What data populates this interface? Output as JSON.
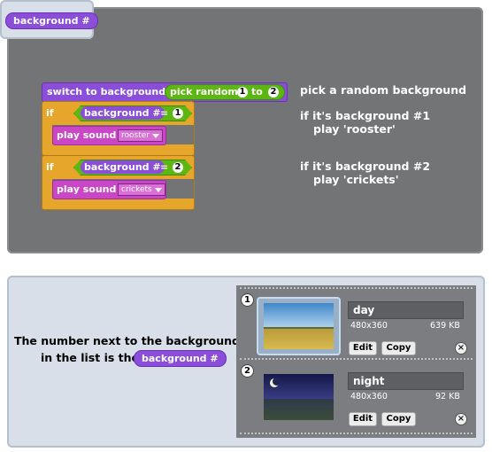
{
  "top_reporter": "background #",
  "script": {
    "switch_label": "switch to background",
    "pick_random_label": "pick random",
    "pick_random_from": "1",
    "pick_random_to_label": "to",
    "pick_random_to": "2",
    "if1": {
      "if_label": "if",
      "predicate_label": "background #",
      "equals": "=",
      "value": "1",
      "play_label": "play sound",
      "sound": "rooster"
    },
    "if2": {
      "if_label": "if",
      "predicate_label": "background #",
      "equals": "=",
      "value": "2",
      "play_label": "play sound",
      "sound": "crickets"
    }
  },
  "notes": {
    "n1": "pick a random background",
    "n2a": "if it's background #1",
    "n2b": "play 'rooster'",
    "n3a": "if it's background #2",
    "n3b": "play 'crickets'"
  },
  "explanation": {
    "line1": "The number next to the background",
    "line2": "in the list is the",
    "reporter": "background #"
  },
  "backgrounds": [
    {
      "index": "1",
      "name": "day",
      "resolution": "480x360",
      "size": "639 KB",
      "edit": "Edit",
      "copy": "Copy",
      "delete": "×"
    },
    {
      "index": "2",
      "name": "night",
      "resolution": "480x360",
      "size": "92 KB",
      "edit": "Edit",
      "copy": "Copy",
      "delete": "×"
    }
  ],
  "colors": {
    "looks_purple": "#8b4ed9",
    "operators_green": "#5cb712",
    "control_orange": "#e6a52b",
    "sound_magenta": "#c947c7",
    "script_area": "#727476",
    "panel_bg": "#d8dfe8"
  }
}
